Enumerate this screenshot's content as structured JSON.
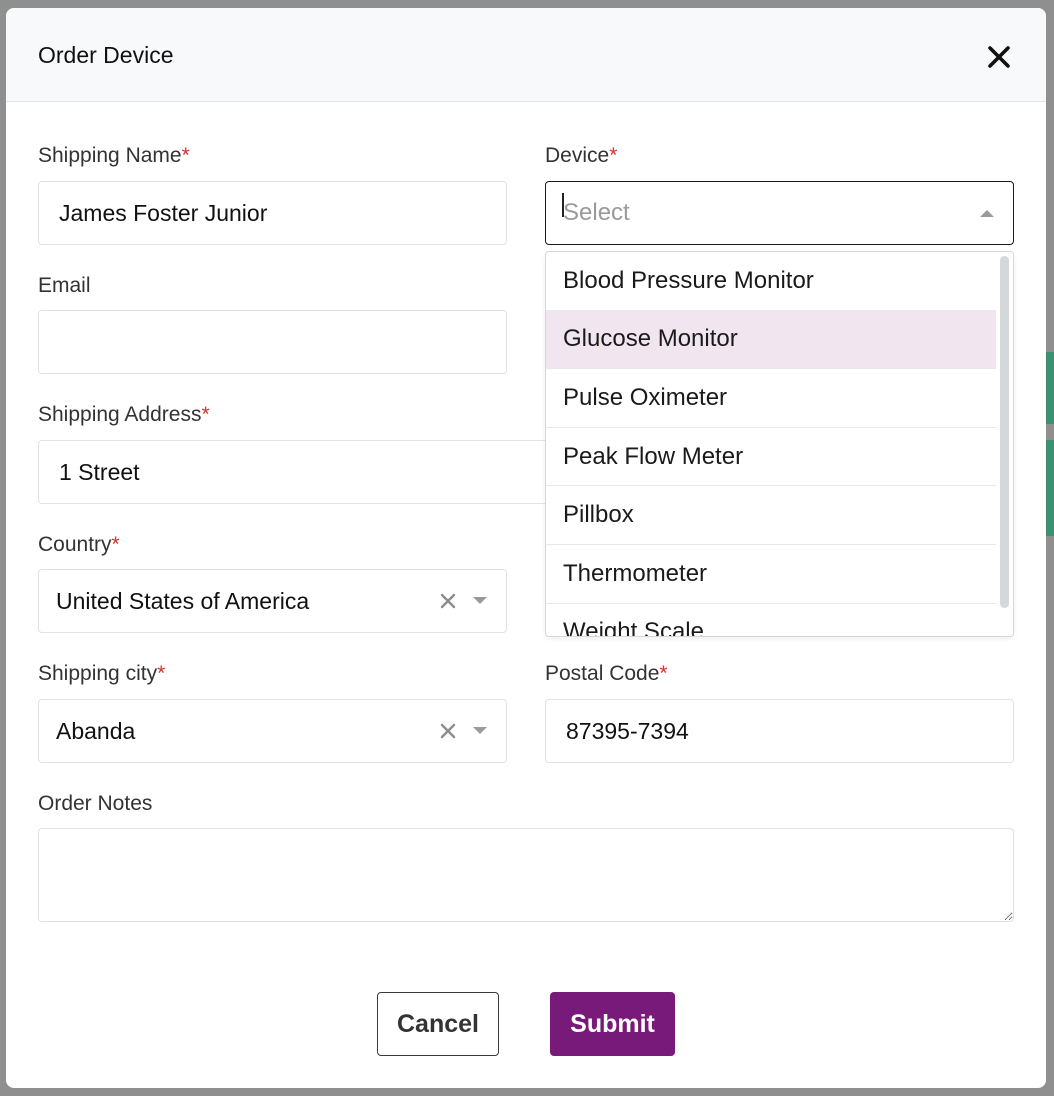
{
  "modal": {
    "title": "Order Device",
    "close_icon": "close-icon"
  },
  "form": {
    "shipping_name": {
      "label": "Shipping Name",
      "required_mark": "*",
      "value": "James Foster Junior"
    },
    "device": {
      "label": "Device",
      "required_mark": "*",
      "placeholder": "Select",
      "options": [
        "Blood Pressure Monitor",
        "Glucose Monitor",
        "Pulse Oximeter",
        "Peak Flow Meter",
        "Pillbox",
        "Thermometer",
        "Weight Scale"
      ],
      "highlighted_option": "Glucose Monitor"
    },
    "email": {
      "label": "Email",
      "value": ""
    },
    "shipping_address": {
      "label": "Shipping Address",
      "required_mark": "*",
      "value": "1 Street"
    },
    "country": {
      "label": "Country",
      "required_mark": "*",
      "value": "United States of America"
    },
    "shipping_city": {
      "label": "Shipping city",
      "required_mark": "*",
      "value": "Abanda"
    },
    "postal_code": {
      "label": "Postal Code",
      "required_mark": "*",
      "value": "87395-7394"
    },
    "order_notes": {
      "label": "Order Notes",
      "value": ""
    }
  },
  "buttons": {
    "cancel_label": "Cancel",
    "submit_label": "Submit"
  },
  "colors": {
    "primary": "#771a7a",
    "required": "#d0342c",
    "highlight": "#f1e6ef"
  }
}
